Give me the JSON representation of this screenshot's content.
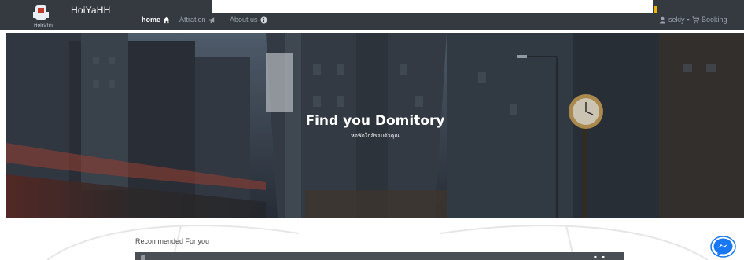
{
  "brand": {
    "name": "HoiYaHH",
    "logo_caption": "HoiYahh"
  },
  "nav": {
    "home": "home",
    "attraction": "Attration",
    "about": "About us",
    "user": "sekiy",
    "booking": "Booking"
  },
  "hero": {
    "title": "Find you Domitory",
    "subtitle": "หอพักใกล้รอบตัวคุณ"
  },
  "recommended": {
    "heading": "Recommended For you"
  },
  "colors": {
    "navbar": "#343a40",
    "accent": "#f0b400",
    "messenger": "#1877f2"
  }
}
